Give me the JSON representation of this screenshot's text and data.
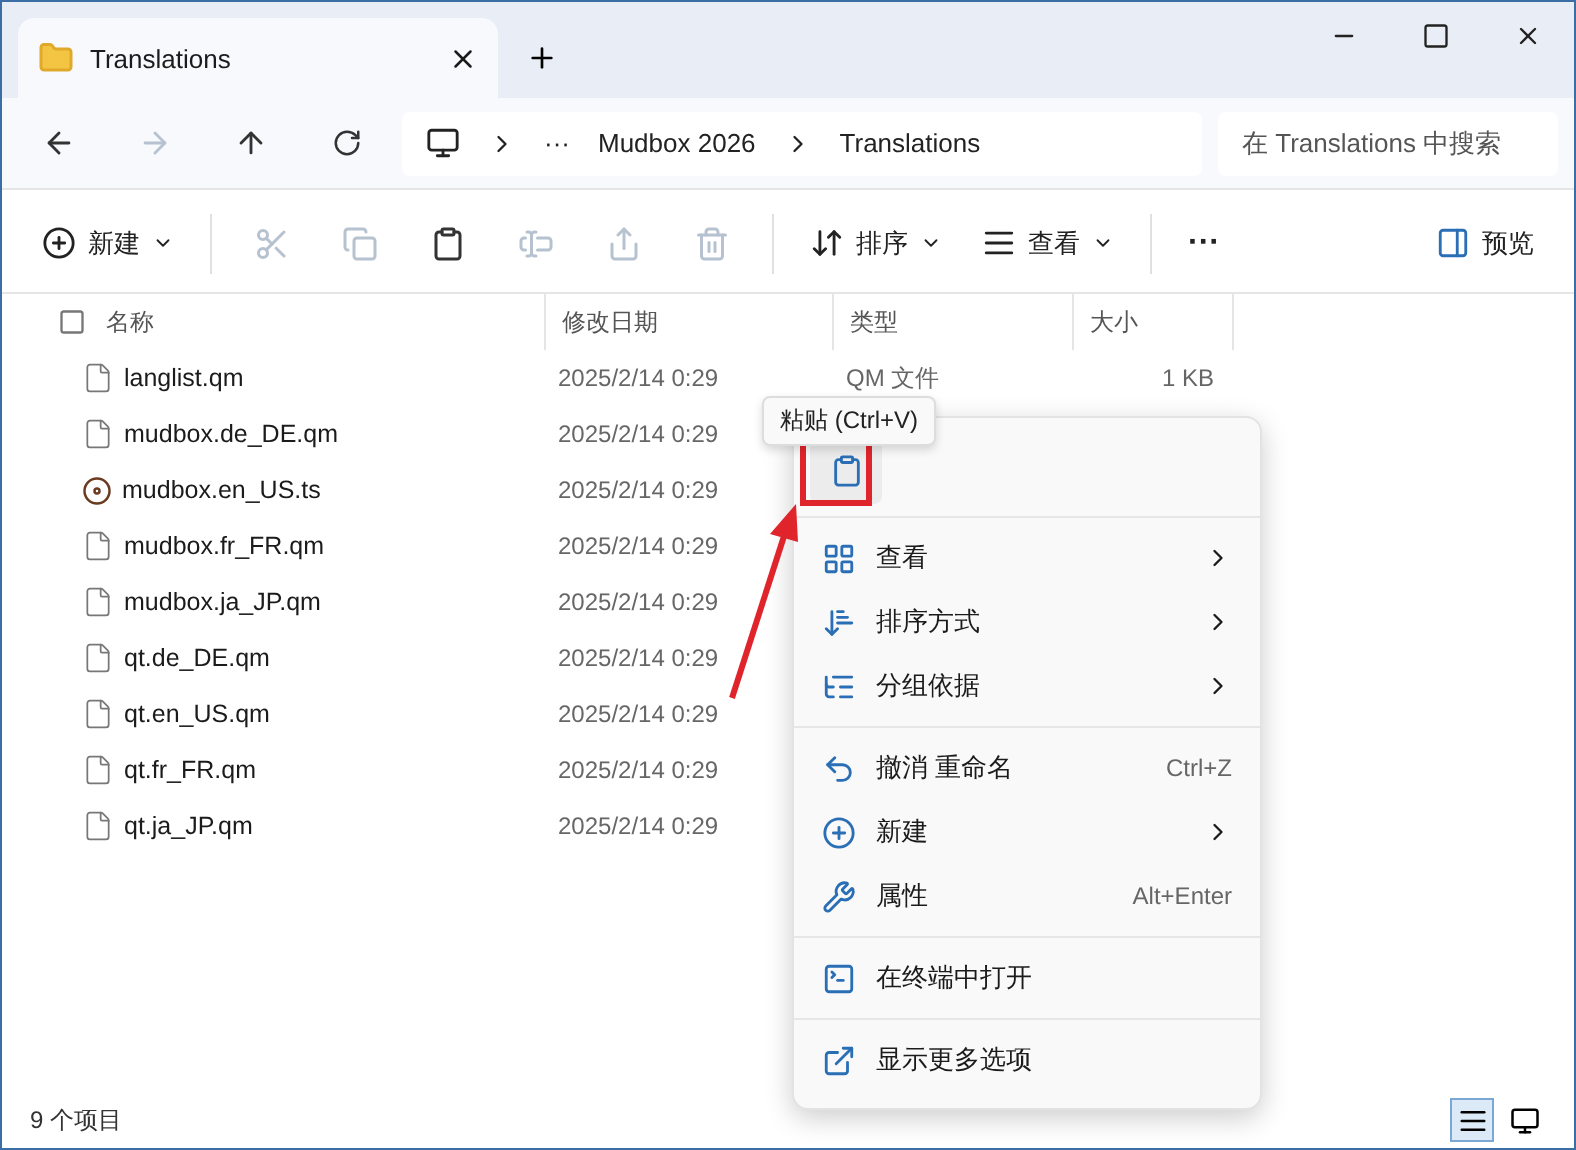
{
  "window": {
    "tab_title": "Translations"
  },
  "address": {
    "ellipsis": "···",
    "crumbs": [
      "Mudbox 2026",
      "Translations"
    ],
    "search_placeholder": "在 Translations 中搜索"
  },
  "toolbar": {
    "new_label": "新建",
    "sort_label": "排序",
    "view_label": "查看",
    "more": "···",
    "preview_label": "预览",
    "actions": [
      {
        "kind": "cut",
        "disabled": true
      },
      {
        "kind": "copy",
        "disabled": true
      },
      {
        "kind": "paste",
        "disabled": false
      },
      {
        "kind": "rename",
        "disabled": true
      },
      {
        "kind": "share",
        "disabled": true
      },
      {
        "kind": "delete",
        "disabled": true
      }
    ]
  },
  "table": {
    "select_all": {
      "checked": false
    },
    "columns": [
      "名称",
      "修改日期",
      "类型",
      "大小"
    ],
    "rows": [
      {
        "name": "langlist.qm",
        "date": "2025/2/14 0:29",
        "type": "QM 文件",
        "size": "1 KB",
        "kind": "doc"
      },
      {
        "name": "mudbox.de_DE.qm",
        "date": "2025/2/14 0:29",
        "kind": "doc"
      },
      {
        "name": "mudbox.en_US.ts",
        "date": "2025/2/14 0:29",
        "kind": "media"
      },
      {
        "name": "mudbox.fr_FR.qm",
        "date": "2025/2/14 0:29",
        "kind": "doc"
      },
      {
        "name": "mudbox.ja_JP.qm",
        "date": "2025/2/14 0:29",
        "kind": "doc"
      },
      {
        "name": "qt.de_DE.qm",
        "date": "2025/2/14 0:29",
        "kind": "doc"
      },
      {
        "name": "qt.en_US.qm",
        "date": "2025/2/14 0:29",
        "kind": "doc"
      },
      {
        "name": "qt.fr_FR.qm",
        "date": "2025/2/14 0:29",
        "kind": "doc"
      },
      {
        "name": "qt.ja_JP.qm",
        "date": "2025/2/14 0:29",
        "kind": "doc"
      }
    ]
  },
  "context_menu": {
    "tooltip": "粘贴 (Ctrl+V)",
    "groups": [
      [
        {
          "label": "查看",
          "submenu": true
        },
        {
          "label": "排序方式",
          "submenu": true
        },
        {
          "label": "分组依据",
          "submenu": true
        }
      ],
      [
        {
          "label": "撤消 重命名",
          "shortcut": "Ctrl+Z",
          "submenu": false
        },
        {
          "label": "新建",
          "submenu": true
        },
        {
          "label": "属性",
          "shortcut": "Alt+Enter",
          "submenu": false
        }
      ],
      [
        {
          "label": "在终端中打开",
          "submenu": false
        }
      ],
      [
        {
          "label": "显示更多选项",
          "submenu": false
        }
      ]
    ]
  },
  "status_bar": {
    "count": "9 个项目",
    "views": [
      {
        "kind": "details",
        "selected": true
      },
      {
        "kind": "tiles",
        "selected": false
      }
    ]
  }
}
